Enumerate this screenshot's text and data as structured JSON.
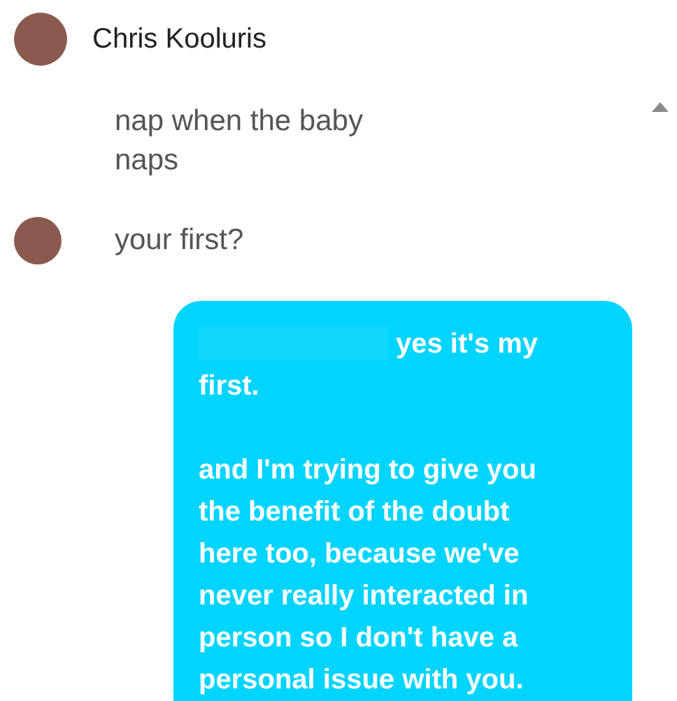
{
  "contact": {
    "name": "Chris Kooluris"
  },
  "messages": [
    {
      "kind": "received",
      "show_avatar": false,
      "text": "nap when the baby naps"
    },
    {
      "kind": "received",
      "show_avatar": true,
      "text": "your first?"
    },
    {
      "kind": "sent",
      "redacted": true,
      "paragraphs": [
        "yes it's my first.",
        "and I'm trying to give you the benefit of the doubt here too, because we've never really interacted in person so I don't have a personal issue with you."
      ]
    }
  ]
}
